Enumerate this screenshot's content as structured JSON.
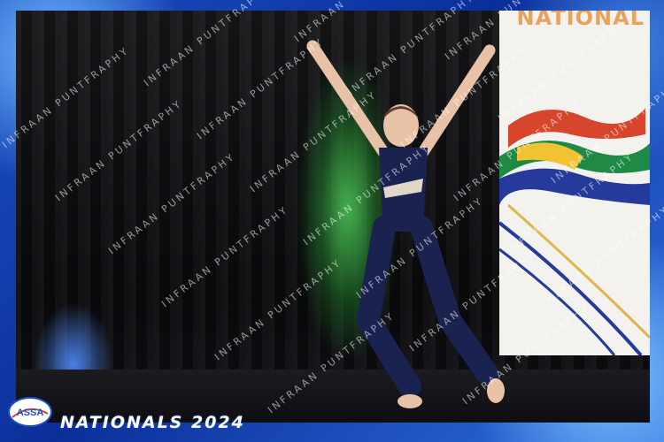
{
  "banner": {
    "title": "NATIONAL"
  },
  "watermark": {
    "text": "INFRAAN PUNTFRAPHY"
  },
  "logo": {
    "text": "ASSA"
  },
  "caption": {
    "text": "NATIONALS 2024"
  },
  "colors": {
    "frame": "#1c4fc4",
    "banner_text": "#e9a25b",
    "green_light": "#50d25a",
    "costume": "#1a2250"
  }
}
